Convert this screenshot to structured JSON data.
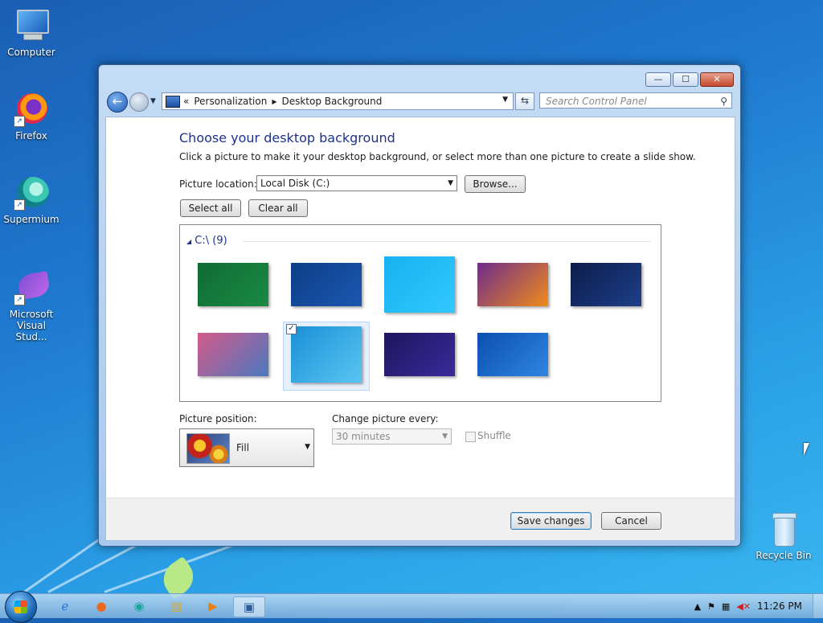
{
  "desktop": {
    "icons": [
      {
        "label": "Computer",
        "icon": "computer-icon"
      },
      {
        "label": "Firefox",
        "icon": "firefox-icon"
      },
      {
        "label": "Supermium",
        "icon": "supermium-icon"
      },
      {
        "label": "Microsoft Visual Stud...",
        "icon": "visual-studio-icon"
      },
      {
        "label": "Recycle Bin",
        "icon": "recycle-bin-icon"
      }
    ]
  },
  "window": {
    "address": {
      "overflow": "«",
      "crumbs": [
        "Personalization",
        "Desktop Background"
      ]
    },
    "search": {
      "placeholder": "Search Control Panel"
    },
    "title": "Choose your desktop background",
    "subtitle": "Click a picture to make it your desktop background, or select more than one picture to create a slide show.",
    "picture_location": {
      "label": "Picture location:",
      "value": "Local Disk (C:)"
    },
    "browse_label": "Browse...",
    "select_all_label": "Select all",
    "clear_all_label": "Clear all",
    "gallery": {
      "group_header": "C:\\ (9)",
      "thumbnails": [
        {
          "colors": [
            "#0f6b34",
            "#1a8a44"
          ],
          "checked": false
        },
        {
          "colors": [
            "#0d3e86",
            "#1b57b0"
          ],
          "checked": false
        },
        {
          "colors": [
            "#16b2f0",
            "#33c7ff"
          ],
          "checked": false
        },
        {
          "colors": [
            "#6e2c8a",
            "#f08a1c"
          ],
          "checked": false
        },
        {
          "colors": [
            "#0b1c4a",
            "#1f3f8a"
          ],
          "checked": false
        },
        {
          "colors": [
            "#d45a8a",
            "#4a78c0"
          ],
          "checked": false
        },
        {
          "colors": [
            "#1a8fd6",
            "#59c6f2"
          ],
          "checked": true
        },
        {
          "colors": [
            "#1d155e",
            "#3a2a9a"
          ],
          "checked": false
        },
        {
          "colors": [
            "#0c4fb0",
            "#2f86e0"
          ],
          "checked": false
        }
      ]
    },
    "picture_position": {
      "label": "Picture position:",
      "value": "Fill"
    },
    "change_picture": {
      "label": "Change picture every:",
      "value": "30 minutes"
    },
    "shuffle_label": "Shuffle",
    "save_label": "Save changes",
    "cancel_label": "Cancel"
  },
  "taskbar": {
    "clock": "11:26 PM"
  }
}
